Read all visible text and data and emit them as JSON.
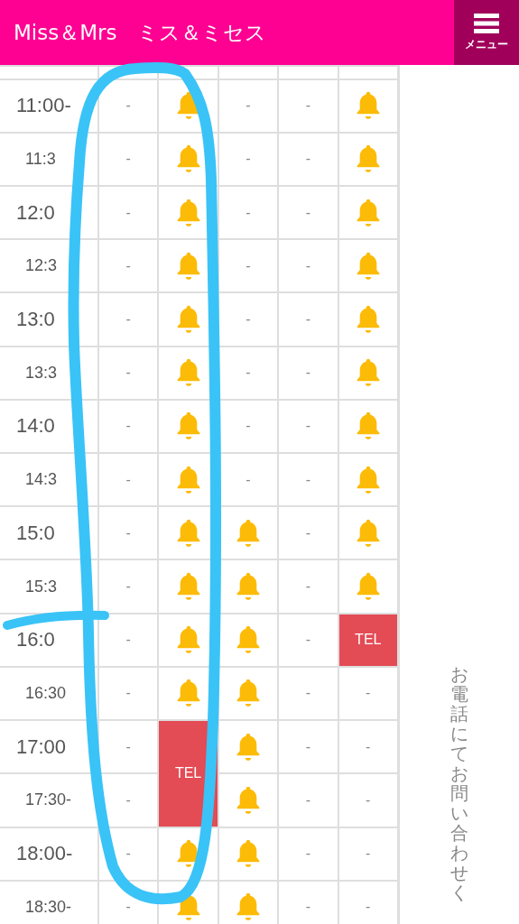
{
  "header": {
    "title": "Miss＆Mrs　ミス＆ミセス",
    "menu_label": "メニュー"
  },
  "rows": [
    {
      "time": "11:00-",
      "half": false,
      "cells": [
        {
          "kind": "none",
          "text": "-"
        },
        {
          "kind": "bell"
        },
        {
          "kind": "none",
          "text": "-"
        },
        {
          "kind": "none",
          "text": "-"
        },
        {
          "kind": "bell"
        }
      ]
    },
    {
      "time": "11:3",
      "half": true,
      "cells": [
        {
          "kind": "none",
          "text": "-"
        },
        {
          "kind": "bell"
        },
        {
          "kind": "none",
          "text": "-"
        },
        {
          "kind": "none",
          "text": "-"
        },
        {
          "kind": "bell"
        }
      ]
    },
    {
      "time": "12:0",
      "half": false,
      "cells": [
        {
          "kind": "none",
          "text": "-"
        },
        {
          "kind": "bell"
        },
        {
          "kind": "none",
          "text": "-"
        },
        {
          "kind": "none",
          "text": "-"
        },
        {
          "kind": "bell"
        }
      ]
    },
    {
      "time": "12:3",
      "half": true,
      "cells": [
        {
          "kind": "none",
          "text": "-"
        },
        {
          "kind": "bell"
        },
        {
          "kind": "none",
          "text": "-"
        },
        {
          "kind": "none",
          "text": "-"
        },
        {
          "kind": "bell"
        }
      ]
    },
    {
      "time": "13:0",
      "half": false,
      "cells": [
        {
          "kind": "none",
          "text": "-"
        },
        {
          "kind": "bell"
        },
        {
          "kind": "none",
          "text": "-"
        },
        {
          "kind": "none",
          "text": "-"
        },
        {
          "kind": "bell"
        }
      ]
    },
    {
      "time": "13:3",
      "half": true,
      "cells": [
        {
          "kind": "none",
          "text": "-"
        },
        {
          "kind": "bell"
        },
        {
          "kind": "none",
          "text": "-"
        },
        {
          "kind": "none",
          "text": "-"
        },
        {
          "kind": "bell"
        }
      ]
    },
    {
      "time": "14:0",
      "half": false,
      "cells": [
        {
          "kind": "none",
          "text": "-"
        },
        {
          "kind": "bell"
        },
        {
          "kind": "none",
          "text": "-"
        },
        {
          "kind": "none",
          "text": "-"
        },
        {
          "kind": "bell"
        }
      ]
    },
    {
      "time": "14:3",
      "half": true,
      "cells": [
        {
          "kind": "none",
          "text": "-"
        },
        {
          "kind": "bell"
        },
        {
          "kind": "none",
          "text": "-"
        },
        {
          "kind": "none",
          "text": "-"
        },
        {
          "kind": "bell"
        }
      ]
    },
    {
      "time": "15:0",
      "half": false,
      "cells": [
        {
          "kind": "none",
          "text": "-"
        },
        {
          "kind": "bell"
        },
        {
          "kind": "bell"
        },
        {
          "kind": "none",
          "text": "-"
        },
        {
          "kind": "bell"
        }
      ]
    },
    {
      "time": "15:3",
      "half": true,
      "cells": [
        {
          "kind": "none",
          "text": "-"
        },
        {
          "kind": "bell"
        },
        {
          "kind": "bell"
        },
        {
          "kind": "none",
          "text": "-"
        },
        {
          "kind": "bell"
        }
      ]
    },
    {
      "time": "16:0",
      "half": false,
      "cells": [
        {
          "kind": "none",
          "text": "-"
        },
        {
          "kind": "bell"
        },
        {
          "kind": "bell"
        },
        {
          "kind": "none",
          "text": "-"
        },
        {
          "kind": "tel",
          "text": "TEL"
        }
      ]
    },
    {
      "time": "16:30",
      "half": true,
      "cells": [
        {
          "kind": "none",
          "text": "-"
        },
        {
          "kind": "bell"
        },
        {
          "kind": "bell"
        },
        {
          "kind": "none",
          "text": "-"
        },
        {
          "kind": "none",
          "text": "-"
        }
      ]
    },
    {
      "time": "17:00",
      "half": false,
      "cells": [
        {
          "kind": "none",
          "text": "-"
        },
        {
          "kind": "tel",
          "text": "TEL"
        },
        {
          "kind": "bell"
        },
        {
          "kind": "none",
          "text": "-"
        },
        {
          "kind": "none",
          "text": "-"
        }
      ]
    },
    {
      "time": "17:30-",
      "half": true,
      "cells": [
        {
          "kind": "none",
          "text": "-"
        },
        {
          "kind": "covered"
        },
        {
          "kind": "bell"
        },
        {
          "kind": "none",
          "text": "-"
        },
        {
          "kind": "none",
          "text": "-"
        }
      ]
    },
    {
      "time": "18:00-",
      "half": false,
      "cells": [
        {
          "kind": "none",
          "text": "-"
        },
        {
          "kind": "bell"
        },
        {
          "kind": "bell"
        },
        {
          "kind": "none",
          "text": "-"
        },
        {
          "kind": "none",
          "text": "-"
        }
      ]
    },
    {
      "time": "18:30-",
      "half": true,
      "cells": [
        {
          "kind": "none",
          "text": "-"
        },
        {
          "kind": "bell"
        },
        {
          "kind": "bell"
        },
        {
          "kind": "none",
          "text": "-"
        },
        {
          "kind": "none",
          "text": "-"
        }
      ]
    }
  ],
  "side_note": "お電話にてお問い合わせく"
}
